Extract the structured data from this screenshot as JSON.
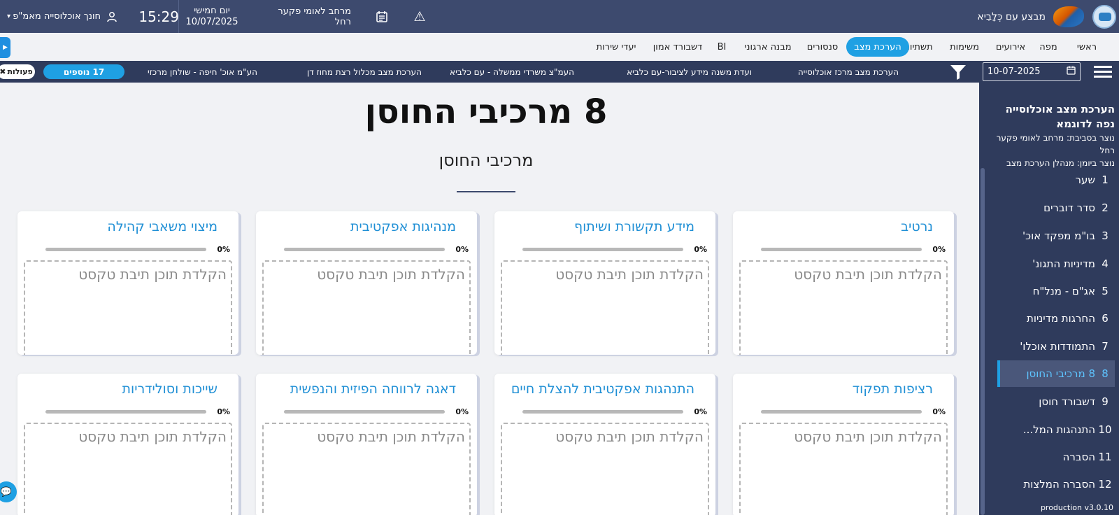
{
  "header": {
    "app_title": "מבצע עם כְּלָבִיא",
    "region": "מרחב לאומי פקער רחל",
    "day": "יום חמישי",
    "date": "10/07/2025",
    "time": "15:29",
    "user": "חונך אוכלוסייה מאמ\"פ",
    "icons": [
      "logo-icon",
      "flag-icon",
      "warning-icon",
      "calendar-icon",
      "user-icon",
      "chevron-down-icon"
    ]
  },
  "nav": {
    "tabs": [
      "ראשי",
      "מפה",
      "אירועים",
      "משימות",
      "תשתיות",
      "הערכת מצב",
      "סנסורים",
      "מבנה ארגוני",
      "BI",
      "דשבורד אמון",
      "יעדי שירות"
    ],
    "active": "הערכת מצב"
  },
  "filters": {
    "date_value": "10-07-2025",
    "events": [
      "הערכת מצב מרכז אוכלוסייה",
      "ועדת משנה מידע לציבור-עם כלביא",
      "העמ\"צ משרדי ממשלה - עם כלביא",
      "הערכת מצב מכלול רצת מחוז דן",
      "הע\"מ אוכ' חיפה - שולחן מרכזי"
    ],
    "more_label": "17 נוספים",
    "actions_label": "פעולות"
  },
  "sidebar": {
    "title": "הערכת מצב אוכלוסייה נפה לדוגמא",
    "created_in": "נוצר בסביבת: מרחב לאומי פקער רחל",
    "created_from": "נוצר ביומן: מנהלן הערכת מצב",
    "items": [
      {
        "num": "1",
        "label": "שער"
      },
      {
        "num": "2",
        "label": "סדר דוברים"
      },
      {
        "num": "3",
        "label": "בו\"מ מפקד אוכ'"
      },
      {
        "num": "4",
        "label": "מדיניות התגונ'"
      },
      {
        "num": "5",
        "label": "אג\"ם - מנל\"ח"
      },
      {
        "num": "6",
        "label": "החרגות מדיניות"
      },
      {
        "num": "7",
        "label": "התמודדות אוכלו'"
      },
      {
        "num": "8",
        "label": "8 מרכיבי החוסן"
      },
      {
        "num": "9",
        "label": "דשבורד חוסן"
      },
      {
        "num": "10",
        "label": "התנהגות המל..."
      },
      {
        "num": "11",
        "label": "הסברה"
      },
      {
        "num": "12",
        "label": "הסברה המלצות"
      }
    ],
    "active_index": 7,
    "version": "production v3.0.10"
  },
  "main": {
    "title": "8 מרכיבי החוסן",
    "subtitle": "מרכיבי החוסן",
    "placeholder": "הקלדת תוכן תיבת טקסט",
    "cards": [
      {
        "title": "נרטיב",
        "percent": "0%",
        "progress": 0
      },
      {
        "title": "מידע תקשורת ושיתוף",
        "percent": "0%",
        "progress": 0
      },
      {
        "title": "מנהיגות אפקטיבית",
        "percent": "0%",
        "progress": 0
      },
      {
        "title": "מיצוי משאבי קהילה",
        "percent": "0%",
        "progress": 0
      },
      {
        "title": "רציפות תפקוד",
        "percent": "0%",
        "progress": 0
      },
      {
        "title": "התנהגות אפקטיבית להצלת חיים",
        "percent": "0%",
        "progress": 0
      },
      {
        "title": "דאגה לרווחה הפיזית והנפשית",
        "percent": "0%",
        "progress": 0
      },
      {
        "title": "שייכות וסולידריות",
        "percent": "0%",
        "progress": 0
      }
    ]
  }
}
